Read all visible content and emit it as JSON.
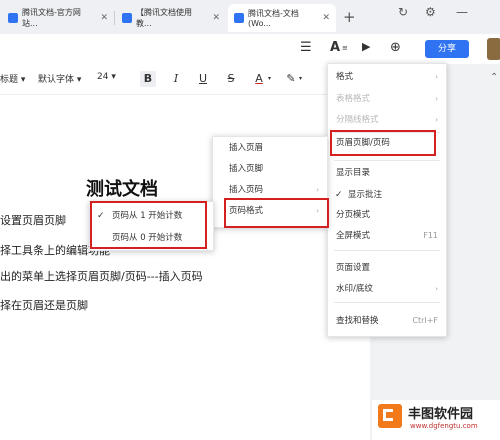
{
  "tabs": [
    {
      "label": "腾讯文档-官方网站...",
      "close": "✕",
      "favicon_color": "#2f73f2",
      "active": false
    },
    {
      "label": "【腾讯文档使用教...",
      "close": "✕",
      "favicon_color": "#2f73f2",
      "active": false
    },
    {
      "label": "腾讯文档-文档(Wo...",
      "close": "✕",
      "favicon_color": "#2f73f2",
      "active": true
    }
  ],
  "new_tab": "+",
  "window_controls": [
    "↻",
    "⚙",
    "—"
  ],
  "toolbar": {
    "menu_icon": "☰",
    "format_icon": "A",
    "play_icon": "▶",
    "add_user_icon": "⊕",
    "share_label": "分享"
  },
  "format_bar": {
    "style": "标题",
    "font": "默认字体",
    "size": "24",
    "bold": "B",
    "italic": "I",
    "underline": "U",
    "strike": "S",
    "font_color": "A",
    "highlight": "✎"
  },
  "document": {
    "title": "测试文档",
    "lines": [
      "设置页眉页脚",
      "择工具条上的编辑功能",
      "出的菜单上选择页眉页脚/页码---插入页码",
      "择在页眉还是页脚"
    ]
  },
  "main_menu": {
    "items": [
      {
        "label": "格式",
        "arrow": "›",
        "disabled": false
      },
      {
        "label": "表格格式",
        "arrow": "›",
        "disabled": true
      },
      {
        "label": "分隔线格式",
        "arrow": "›",
        "disabled": true
      },
      {
        "label": "页眉页脚/页码",
        "disabled": false
      },
      {
        "label": "显示目录",
        "disabled": false
      },
      {
        "label": "显示批注",
        "check": "✓",
        "disabled": false
      },
      {
        "label": "分页模式",
        "disabled": false
      },
      {
        "label": "全屏模式",
        "shortcut": "F11",
        "disabled": false
      },
      {
        "label": "页面设置",
        "disabled": false
      },
      {
        "label": "水印/底纹",
        "arrow": "›",
        "disabled": false
      },
      {
        "label": "查找和替换",
        "shortcut": "Ctrl+F",
        "disabled": false
      }
    ]
  },
  "sub_menu": {
    "items": [
      {
        "label": "插入页眉"
      },
      {
        "label": "插入页脚"
      },
      {
        "label": "插入页码",
        "arrow": "›"
      },
      {
        "label": "页码格式",
        "arrow": "›"
      }
    ]
  },
  "page_number_menu": {
    "items": [
      {
        "label": "页码从 1 开始计数",
        "check": "✓"
      },
      {
        "label": "页码从 0 开始计数"
      }
    ]
  },
  "watermark": {
    "name": "丰图软件园",
    "url": "www.dgfengtu.com"
  },
  "colors": {
    "accent": "#2f73f2",
    "annotation": "#d42020",
    "watermark_logo": "#f27a1a"
  }
}
